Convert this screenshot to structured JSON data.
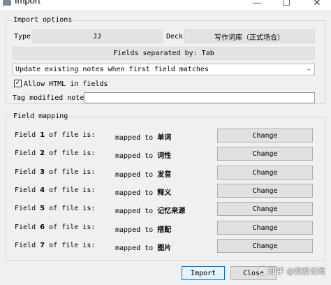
{
  "window": {
    "title": "Import",
    "minimize": "—",
    "maximize": "☐",
    "close": "✕"
  },
  "import_options": {
    "title": "Import options",
    "type_label": "Type",
    "type_value": "JJ",
    "deck_label": "Deck",
    "deck_value": "写作词库（正式场合）",
    "separator_label": "Fields separated by: Tab",
    "update_mode": "Update existing notes when first field matches",
    "combo_arrow": "⌄",
    "allow_html_label": "Allow HTML in fields",
    "allow_html_checked": true,
    "check_mark": "✓",
    "tag_label": "Tag modified notes:",
    "tag_value": ""
  },
  "field_mapping": {
    "title": "Field mapping",
    "prefix": "Field",
    "middle": "of file is:",
    "mapped_text": "mapped to",
    "change_label": "Change",
    "rows": [
      {
        "num": "1",
        "target": "单词"
      },
      {
        "num": "2",
        "target": "词性"
      },
      {
        "num": "3",
        "target": "发音"
      },
      {
        "num": "4",
        "target": "释义"
      },
      {
        "num": "5",
        "target": "记忆来源"
      },
      {
        "num": "6",
        "target": "搭配"
      },
      {
        "num": "7",
        "target": "图片"
      }
    ]
  },
  "footer": {
    "import_label": "Import",
    "close_label": "Close"
  },
  "watermark": {
    "text": "知乎 @我爱记词"
  }
}
